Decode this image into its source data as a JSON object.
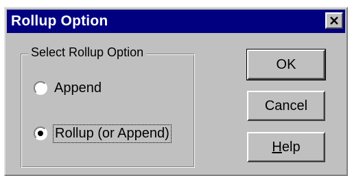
{
  "window": {
    "title": "Rollup Option"
  },
  "group": {
    "label": "Select Rollup Option",
    "options": [
      {
        "label": "Append",
        "selected": false
      },
      {
        "label": "Rollup (or Append)",
        "selected": true
      }
    ]
  },
  "buttons": {
    "ok": "OK",
    "cancel": "Cancel",
    "help_mnemonic": "H",
    "help_rest": "elp"
  },
  "colors": {
    "titlebar": "#000080",
    "face": "#c0c0c0"
  },
  "icons": {
    "close": "close-icon"
  }
}
